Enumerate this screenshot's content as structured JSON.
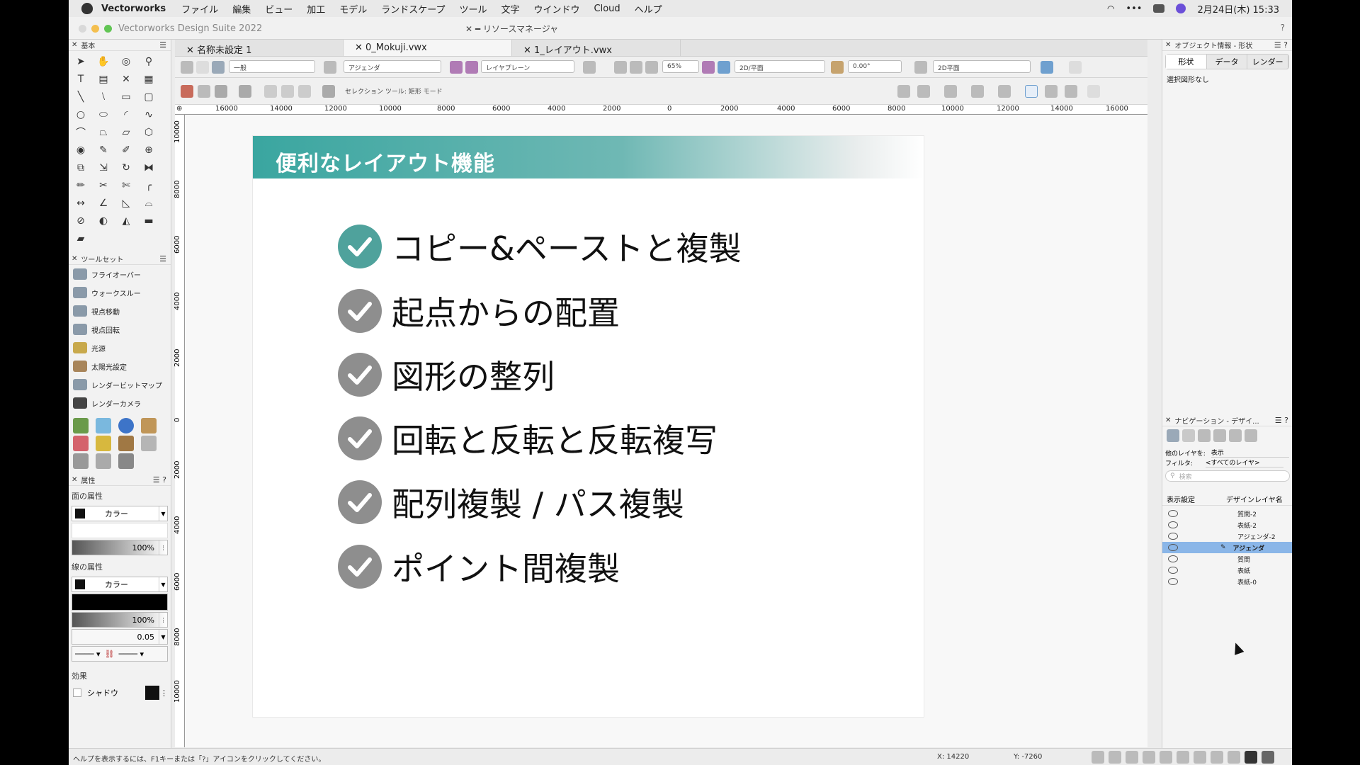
{
  "menubar": {
    "app": "Vectorworks",
    "items": [
      "ファイル",
      "編集",
      "ビュー",
      "加工",
      "モデル",
      "ランドスケープ",
      "ツール",
      "文字",
      "ウインドウ",
      "Cloud",
      "ヘルプ"
    ],
    "datetime": "2月24日(木) 15:33"
  },
  "window": {
    "title": "Vectorworks Design Suite 2022",
    "resource_manager": "リソースマネージャ",
    "help": "?"
  },
  "tabs": [
    "名称未設定 1",
    "0_Mokuji.vwx",
    "1_レイアウト.vwx"
  ],
  "toolbar": {
    "class": "一般",
    "layer": "アジェンダ",
    "sheet": "レイヤプレーン",
    "zoom": "65%",
    "view": "2D/平面",
    "angle": "0.00°",
    "plane": "2D平面",
    "mode_label": "セレクション ツール: 矩形 モード"
  },
  "ruler": {
    "h": [
      "16000",
      "14000",
      "12000",
      "10000",
      "8000",
      "6000",
      "4000",
      "2000",
      "0",
      "2000",
      "4000",
      "6000",
      "8000",
      "10000",
      "12000",
      "14000",
      "16000"
    ],
    "v": [
      "10000",
      "8000",
      "6000",
      "4000",
      "2000",
      "0",
      "2000",
      "4000",
      "6000",
      "8000",
      "10000"
    ]
  },
  "left": {
    "basic_title": "基本",
    "toolset_title": "ツールセット",
    "toolset_items": [
      "フライオーバー",
      "ウォークスルー",
      "視点移動",
      "視点回転",
      "光源",
      "太陽光設定",
      "レンダービットマップ",
      "レンダーカメラ"
    ],
    "attr_title": "属性",
    "fill_label": "面の属性",
    "fill_color": "カラー",
    "fill_opacity": "100%",
    "line_label": "線の属性",
    "line_color": "カラー",
    "line_opacity": "100%",
    "line_weight": "0.05",
    "effect_label": "効果",
    "shadow_label": "シャドウ"
  },
  "slide": {
    "title": "便利なレイアウト機能",
    "items": [
      "コピー&ペーストと複製",
      "起点からの配置",
      "図形の整列",
      "回転と反転と反転複写",
      "配列複製 / パス複製",
      "ポイント間複製"
    ]
  },
  "right": {
    "objinfo_title": "オブジェクト情報 - 形状",
    "tabs": [
      "形状",
      "データ",
      "レンダー"
    ],
    "no_selection": "選択図形なし",
    "nav_title": "ナビゲーション - デザイ...",
    "other_layers_label": "他のレイヤを:",
    "other_layers_value": "表示",
    "filter_label": "フィルタ:",
    "filter_value": "<すべてのレイヤ>",
    "search_placeholder": "検索",
    "col_visibility": "表示設定",
    "col_layer": "デザインレイヤ名",
    "layers": [
      "質問-2",
      "表紙-2",
      "アジェンダ-2",
      "アジェンダ",
      "質問",
      "表紙",
      "表紙-0"
    ]
  },
  "status": {
    "help": "ヘルプを表示するには、F1キーまたは「?」アイコンをクリックしてください。",
    "x": "X: 14220",
    "y": "Y: -7260"
  },
  "colors": {
    "accent": "#3aa6a0",
    "selection": "#8ab6e8"
  }
}
